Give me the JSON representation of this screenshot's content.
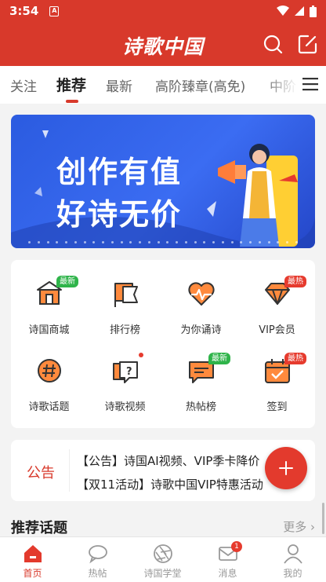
{
  "status_bar": {
    "time": "3:54",
    "notification_icon_letter": "A"
  },
  "app": {
    "logo_text": "诗歌中国",
    "brand_color": "#d8392b"
  },
  "tabs": [
    {
      "label": "关注"
    },
    {
      "label": "推荐",
      "active": true
    },
    {
      "label": "最新"
    },
    {
      "label": "高阶臻章(高免)"
    },
    {
      "label": "中阶"
    }
  ],
  "banner": {
    "line1": "创作有值",
    "line2": "好诗无价"
  },
  "grid": [
    {
      "label": "诗国商城",
      "icon": "shop-icon",
      "badge": "最新",
      "badge_color": "green"
    },
    {
      "label": "排行榜",
      "icon": "ranking-flag-icon"
    },
    {
      "label": "为你诵诗",
      "icon": "heart-pulse-icon"
    },
    {
      "label": "VIP会员",
      "icon": "diamond-icon",
      "badge": "最热",
      "badge_color": "red"
    },
    {
      "label": "诗歌话题",
      "icon": "hashtag-icon"
    },
    {
      "label": "诗歌视频",
      "icon": "video-chat-icon",
      "dot": true
    },
    {
      "label": "热帖榜",
      "icon": "hot-post-icon",
      "badge": "最新",
      "badge_color": "green"
    },
    {
      "label": "签到",
      "icon": "calendar-checkin-icon",
      "badge": "最热",
      "badge_color": "red"
    }
  ],
  "notice": {
    "tag": "公告",
    "items": [
      "【公告】诗国AI视频、VIP季卡降价",
      "【双11活动】诗歌中国VIP特惠活动"
    ]
  },
  "section": {
    "title": "推荐话题",
    "more": "更多"
  },
  "bottom_nav": [
    {
      "label": "首页",
      "icon": "home-icon",
      "active": true
    },
    {
      "label": "热帖",
      "icon": "chat-bubble-icon"
    },
    {
      "label": "诗国学堂",
      "icon": "aperture-icon"
    },
    {
      "label": "消息",
      "icon": "mail-icon",
      "badge": "1"
    },
    {
      "label": "我的",
      "icon": "person-icon"
    }
  ]
}
